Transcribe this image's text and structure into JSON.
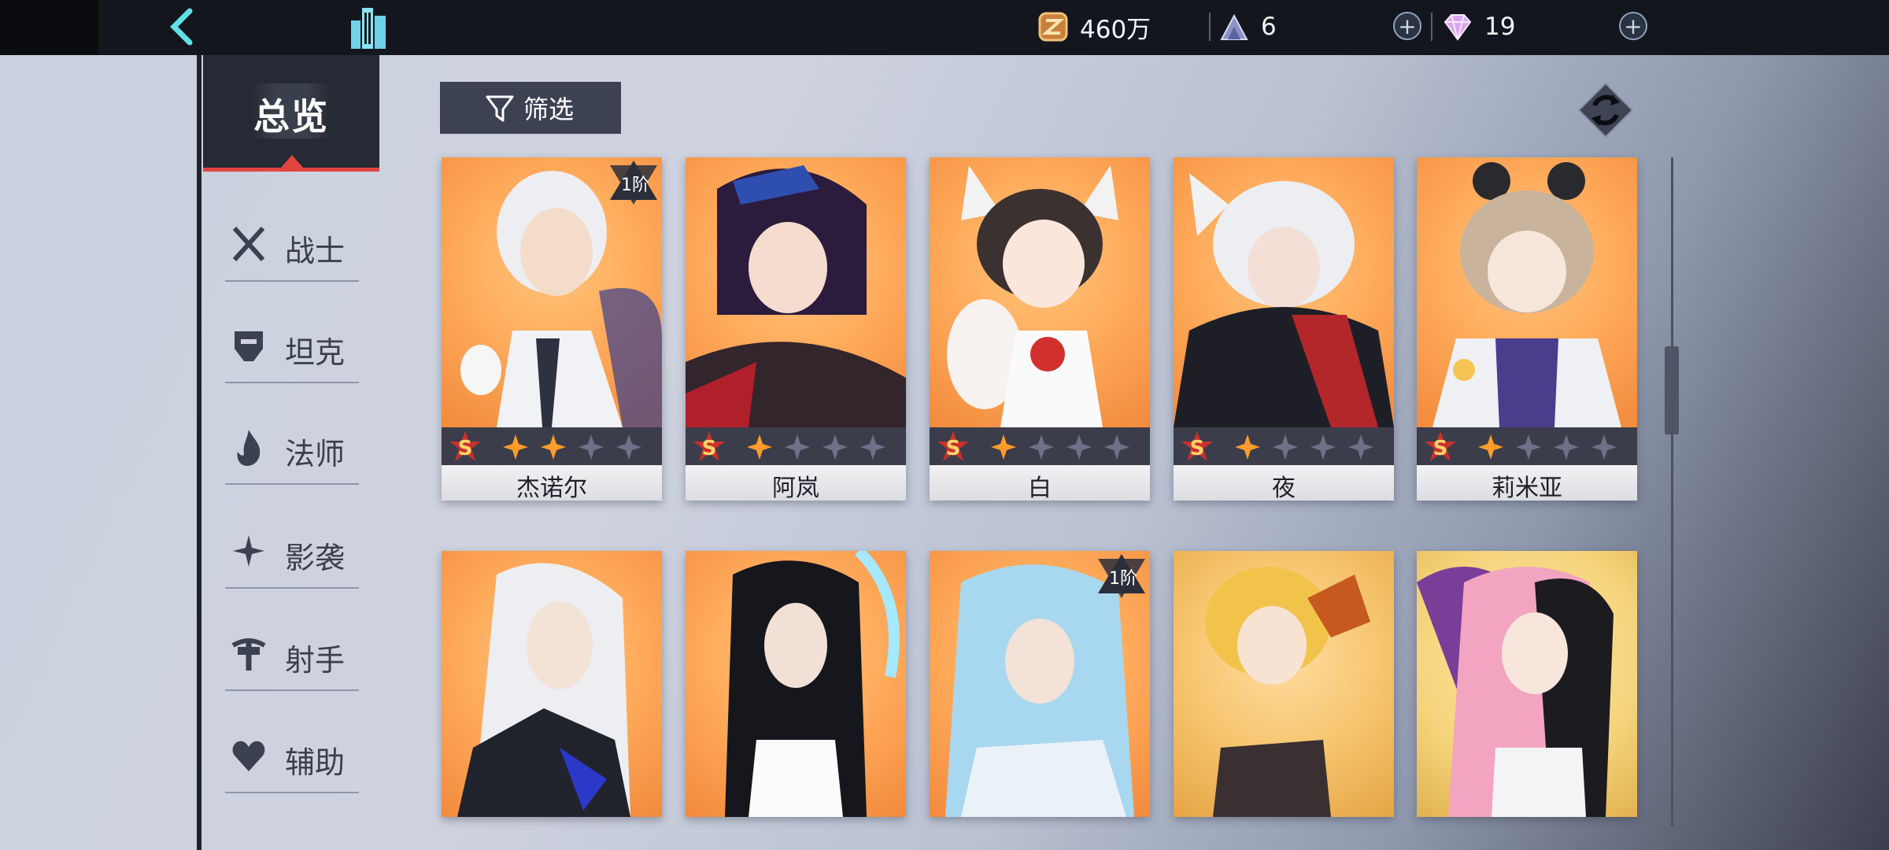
{
  "topbar": {
    "back_icon": "back-arrow-icon",
    "city_icon": "city-buildings-icon",
    "gold": "460万",
    "energy": "6",
    "gems": "19",
    "plus": "+"
  },
  "sidebar": {
    "title": "总览",
    "items": [
      {
        "label": "战士",
        "icon": "crossed-swords-icon"
      },
      {
        "label": "坦克",
        "icon": "helmet-icon"
      },
      {
        "label": "法师",
        "icon": "flame-icon"
      },
      {
        "label": "影袭",
        "icon": "shuriken-icon"
      },
      {
        "label": "射手",
        "icon": "crossbow-icon"
      },
      {
        "label": "辅助",
        "icon": "heart-icon"
      }
    ]
  },
  "filter": {
    "label": "筛选",
    "icon": "funnel-icon"
  },
  "refresh_icon": "cycle-arrows-icon",
  "colors": {
    "accent_red": "#e2443f",
    "card_bg": "#ffab5c",
    "rank_bar": "#3b3d4a"
  },
  "heroes": [
    {
      "name": "杰诺尔",
      "grade": "S",
      "stars_lit": 2,
      "tier": "1阶"
    },
    {
      "name": "阿岚",
      "grade": "S",
      "stars_lit": 1,
      "tier": ""
    },
    {
      "name": "白",
      "grade": "S",
      "stars_lit": 1,
      "tier": ""
    },
    {
      "name": "夜",
      "grade": "S",
      "stars_lit": 1,
      "tier": ""
    },
    {
      "name": "莉米亚",
      "grade": "S",
      "stars_lit": 1,
      "tier": ""
    },
    {
      "name": "",
      "tier": ""
    },
    {
      "name": "",
      "tier": ""
    },
    {
      "name": "",
      "tier": "1阶"
    },
    {
      "name": "",
      "tier": ""
    },
    {
      "name": "",
      "tier": ""
    }
  ]
}
